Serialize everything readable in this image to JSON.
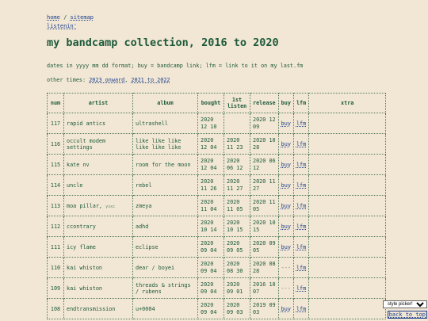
{
  "nav": {
    "home": "home",
    "sep": "/",
    "sitemap": "sitemap",
    "listenin": "listenin'"
  },
  "title": "my bandcamp collection, 2016 to 2020",
  "description": "dates in yyyy mm dd format; buy = bandcamp link; lfm = link to it on my last.fm",
  "other": {
    "label": "other times:",
    "link1": "2023 onward",
    "comma": ",",
    "link2": "2021 to 2022"
  },
  "headers": [
    "num",
    "artist",
    "album",
    "bought",
    "1st listen",
    "release",
    "buy",
    "lfm",
    "xtra"
  ],
  "rows": [
    {
      "num": "117",
      "artist": "rapid antics",
      "tag": "",
      "album": "ultrashell",
      "bought": "2020 12 10",
      "listen": "",
      "release": "2020 12 09",
      "buy": "buy",
      "lfm": "lfm"
    },
    {
      "num": "116",
      "artist": "occult modem settings",
      "tag": "",
      "album": "like like like like like like",
      "bought": "2020 12 04",
      "listen": "2020 11 23",
      "release": "2020 10 28",
      "buy": "buy",
      "lfm": "lfm"
    },
    {
      "num": "115",
      "artist": "kate nv",
      "tag": "",
      "album": "room for the moon",
      "bought": "2020 12 04",
      "listen": "2020 06 12",
      "release": "2020 06 12",
      "buy": "buy",
      "lfm": "lfm"
    },
    {
      "num": "114",
      "artist": "uncle",
      "tag": "",
      "album": "rebel",
      "bought": "2020 11 26",
      "listen": "2020 11 27",
      "release": "2020 11 27",
      "buy": "buy",
      "lfm": "lfm"
    },
    {
      "num": "113",
      "artist": "moa pillar,",
      "tag": "узхс",
      "album": "zmeya",
      "bought": "2020 11 04",
      "listen": "2020 11 05",
      "release": "2020 11 05",
      "buy": "buy",
      "lfm": "lfm"
    },
    {
      "num": "112",
      "artist": "ccontrary",
      "tag": "",
      "album": "adhd",
      "bought": "2020 10 14",
      "listen": "2020 10 15",
      "release": "2020 10 15",
      "buy": "buy",
      "lfm": "lfm"
    },
    {
      "num": "111",
      "artist": "icy flame",
      "tag": "",
      "album": "eclipse",
      "bought": "2020 09 04",
      "listen": "2020 09 05",
      "release": "2020 09 05",
      "buy": "buy",
      "lfm": "lfm"
    },
    {
      "num": "110",
      "artist": "kai whiston",
      "tag": "",
      "album": "dear / boyei",
      "bought": "2020 09 04",
      "listen": "2020 08 30",
      "release": "2020 08 28",
      "buy": "---",
      "lfm": "lfm"
    },
    {
      "num": "109",
      "artist": "kai whiston",
      "tag": "",
      "album": "threads & strings / rubens",
      "bought": "2020 09 04",
      "listen": "2020 09 01",
      "release": "2016 10 07",
      "buy": "---",
      "lfm": "lfm"
    },
    {
      "num": "108",
      "artist": "endtransmission",
      "tag": "",
      "album": "u+0004",
      "bought": "2020 09 04",
      "listen": "2020 09 03",
      "release": "2019 09 03",
      "buy": "buy",
      "lfm": "lfm"
    }
  ],
  "style_picker": "style picker!",
  "back_to_top": "back to top",
  "colors": {
    "background": "#f2e7d5",
    "text": "#1d5a3a",
    "link": "#1a3f8c"
  }
}
